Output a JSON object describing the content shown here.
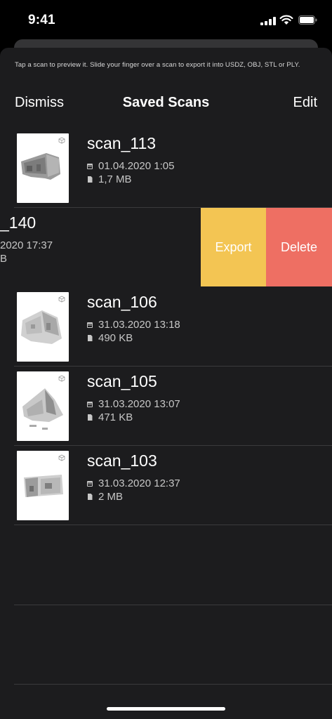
{
  "status_bar": {
    "time": "9:41"
  },
  "hint_text": "Tap a scan to preview it. Slide your finger over a scan to export it into USDZ, OBJ, STL or PLY.",
  "nav": {
    "dismiss_label": "Dismiss",
    "title": "Saved Scans",
    "edit_label": "Edit"
  },
  "scans": [
    {
      "name": "scan_113",
      "date": "01.04.2020 1:05",
      "size": "1,7 MB"
    },
    {
      "name": "_140",
      "date": "2020 17:37",
      "size": "B"
    },
    {
      "name": "scan_106",
      "date": "31.03.2020 13:18",
      "size": "490 KB"
    },
    {
      "name": "scan_105",
      "date": "31.03.2020 13:07",
      "size": "471 KB"
    },
    {
      "name": "scan_103",
      "date": "31.03.2020 12:37",
      "size": "2 MB"
    }
  ],
  "actions": {
    "export_label": "Export",
    "delete_label": "Delete"
  },
  "colors": {
    "export": "#f3c553",
    "delete": "#ee6f63",
    "sheet": "#1c1c1e"
  },
  "icons": {
    "date": "calendar-icon",
    "size": "file-icon",
    "thumb_badge": "cube-icon"
  }
}
